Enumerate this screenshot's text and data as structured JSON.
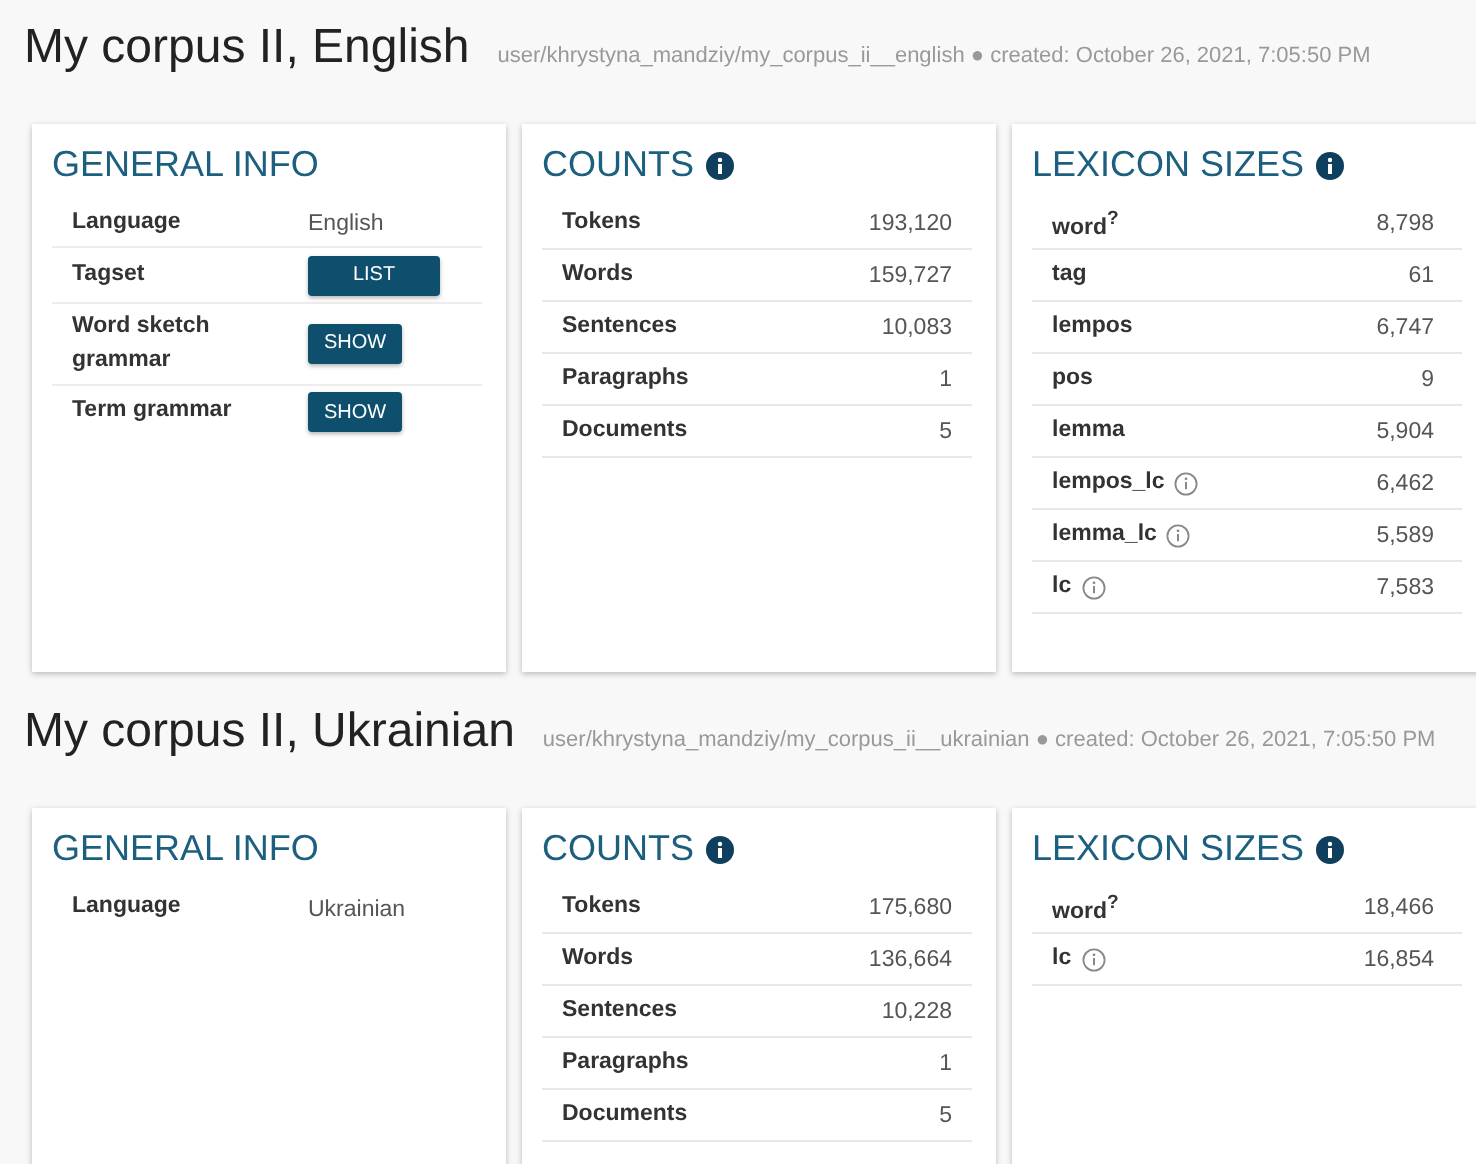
{
  "corpora": [
    {
      "title": "My corpus II, English",
      "path": "user/khrystyna_mandziy/my_corpus_ii__english",
      "separator": "●",
      "created": "created: October 26, 2021, 7:05:50 PM",
      "general_info": {
        "heading": "GENERAL INFO",
        "rows": [
          {
            "kind": "text",
            "label": "Language",
            "value": "English"
          },
          {
            "kind": "button",
            "label": "Tagset",
            "value": "LIST"
          },
          {
            "kind": "button",
            "label": "Word sketch grammar",
            "value": "SHOW"
          },
          {
            "kind": "button",
            "label": "Term grammar",
            "value": "SHOW"
          }
        ]
      },
      "counts": {
        "heading": "COUNTS",
        "rows": [
          {
            "label": "Tokens",
            "value": "193,120"
          },
          {
            "label": "Words",
            "value": "159,727"
          },
          {
            "label": "Sentences",
            "value": "10,083"
          },
          {
            "label": "Paragraphs",
            "value": "1"
          },
          {
            "label": "Documents",
            "value": "5"
          }
        ]
      },
      "lexicon": {
        "heading": "LEXICON SIZES",
        "rows": [
          {
            "label": "word$^{?}$",
            "value": "8,798",
            "info": false
          },
          {
            "label": "tag",
            "value": "61",
            "info": false
          },
          {
            "label": "lempos",
            "value": "6,747",
            "info": false
          },
          {
            "label": "pos",
            "value": "9",
            "info": false
          },
          {
            "label": "lemma",
            "value": "5,904",
            "info": false
          },
          {
            "label": "lempos_lc",
            "value": "6,462",
            "info": true
          },
          {
            "label": "lemma_lc",
            "value": "5,589",
            "info": true
          },
          {
            "label": "lc",
            "value": "7,583",
            "info": true
          }
        ]
      }
    },
    {
      "title": "My corpus II, Ukrainian",
      "path": "user/khrystyna_mandziy/my_corpus_ii__ukrainian",
      "separator": "●",
      "created": "created: October 26, 2021, 7:05:50 PM",
      "general_info": {
        "heading": "GENERAL INFO",
        "rows": [
          {
            "kind": "text",
            "label": "Language",
            "value": "Ukrainian"
          }
        ]
      },
      "counts": {
        "heading": "COUNTS",
        "rows": [
          {
            "label": "Tokens",
            "value": "175,680"
          },
          {
            "label": "Words",
            "value": "136,664"
          },
          {
            "label": "Sentences",
            "value": "10,228"
          },
          {
            "label": "Paragraphs",
            "value": "1"
          },
          {
            "label": "Documents",
            "value": "5"
          }
        ]
      },
      "lexicon": {
        "heading": "LEXICON SIZES",
        "rows": [
          {
            "label": "word$^{?}$",
            "value": "18,466",
            "info": false
          },
          {
            "label": "lc",
            "value": "16,854",
            "info": true
          }
        ]
      }
    }
  ]
}
